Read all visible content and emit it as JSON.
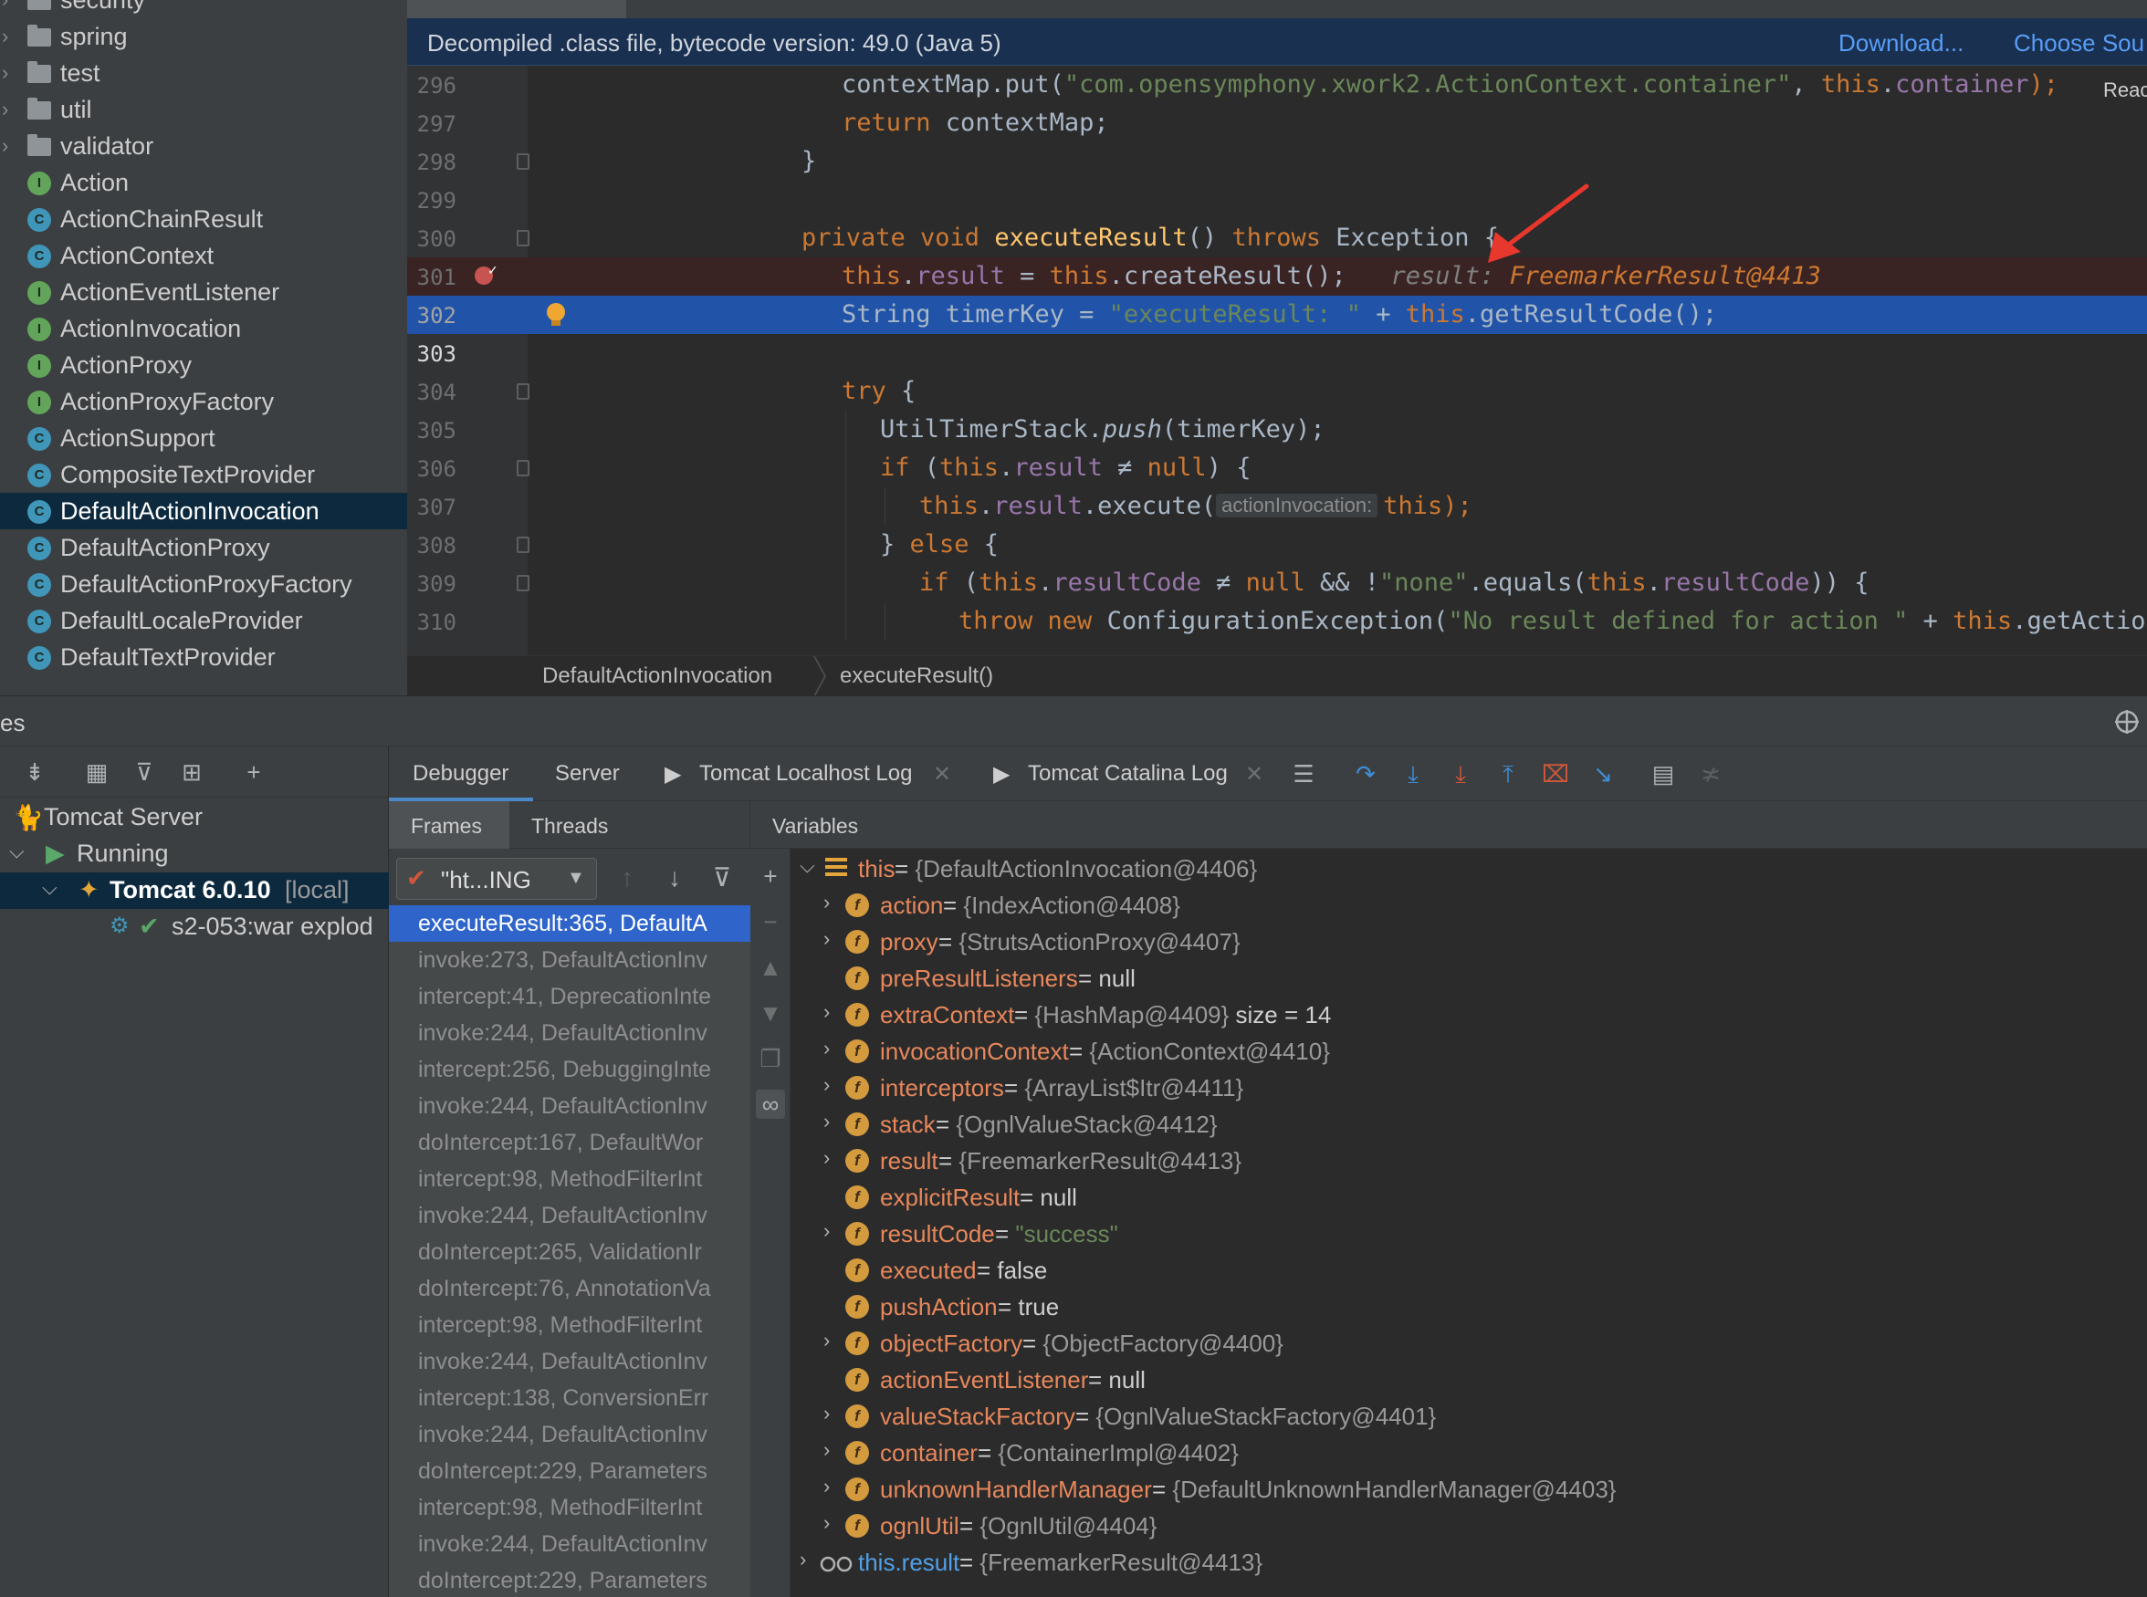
{
  "project": {
    "items": [
      {
        "label": "security",
        "kind": "folder"
      },
      {
        "label": "spring",
        "kind": "folder"
      },
      {
        "label": "test",
        "kind": "folder"
      },
      {
        "label": "util",
        "kind": "folder"
      },
      {
        "label": "validator",
        "kind": "folder"
      },
      {
        "label": "Action",
        "kind": "interface"
      },
      {
        "label": "ActionChainResult",
        "kind": "class"
      },
      {
        "label": "ActionContext",
        "kind": "class"
      },
      {
        "label": "ActionEventListener",
        "kind": "interface"
      },
      {
        "label": "ActionInvocation",
        "kind": "interface"
      },
      {
        "label": "ActionProxy",
        "kind": "interface"
      },
      {
        "label": "ActionProxyFactory",
        "kind": "interface"
      },
      {
        "label": "ActionSupport",
        "kind": "class"
      },
      {
        "label": "CompositeTextProvider",
        "kind": "class"
      },
      {
        "label": "DefaultActionInvocation",
        "kind": "class",
        "selected": true
      },
      {
        "label": "DefaultActionProxy",
        "kind": "class"
      },
      {
        "label": "DefaultActionProxyFactory",
        "kind": "class"
      },
      {
        "label": "DefaultLocaleProvider",
        "kind": "class"
      },
      {
        "label": "DefaultTextProvider",
        "kind": "class"
      }
    ],
    "class_icon_letter": "C",
    "interface_icon_letter": "I"
  },
  "editor": {
    "banner": {
      "text": "Decompiled .class file, bytecode version: 49.0 (Java 5)",
      "download": "Download...",
      "choose_sources": "Choose Sou"
    },
    "read_label": "Reac",
    "line_numbers": [
      "296",
      "297",
      "298",
      "299",
      "300",
      "301",
      "302",
      "303",
      "304",
      "305",
      "306",
      "307",
      "308",
      "309",
      "310"
    ],
    "code": {
      "l296": {
        "a": "contextMap.put(",
        "b": "\"com.opensymphony.xwork2.ActionContext.container\"",
        "c": ", ",
        "d": "this",
        "e": ".",
        "f": "container",
        "g": ");"
      },
      "l297": {
        "a": "return",
        "b": " contextMap;"
      },
      "l298": {
        "a": "}"
      },
      "l300": {
        "a": "private void ",
        "b": "executeResult",
        "c": "() ",
        "d": "throws",
        "e": " Exception {"
      },
      "l301": {
        "a": "this",
        "b": ".",
        "c": "result",
        "d": " = ",
        "e": "this",
        "f": ".createResult();",
        "hint": "result: ",
        "hint_val": "FreemarkerResult@4413"
      },
      "l302": {
        "a": "String timerKey = ",
        "b": "\"executeResult: \"",
        "c": " + ",
        "d": "this",
        "e": ".getResultCode();"
      },
      "l304": {
        "a": "try",
        "b": " {"
      },
      "l305": {
        "a": "UtilTimerStack.",
        "b": "push",
        "c": "(timerKey);"
      },
      "l306": {
        "a": "if",
        "b": " (",
        "c": "this",
        "d": ".",
        "e": "result",
        "f": " ≠ ",
        "g": "null",
        "h": ") {"
      },
      "l307": {
        "a": "this",
        "b": ".",
        "c": "result",
        "d": ".execute(",
        "hint": "actionInvocation:",
        "e": "this",
        "f": ");"
      },
      "l308": {
        "a": "} ",
        "b": "else",
        "c": " {"
      },
      "l309": {
        "a": "if",
        "b": " (",
        "c": "this",
        "d": ".",
        "e": "resultCode",
        "f": " ≠ ",
        "g": "null",
        "h": " && !",
        "i": "\"none\"",
        "j": ".equals(",
        "k": "this",
        "l": ".",
        "m": "resultCode",
        "n": ")) {"
      },
      "l310": {
        "a": "throw new",
        "b": " ConfigurationException(",
        "c": "\"No result defined for action \"",
        "d": " + ",
        "e": "this",
        "f": ".getAction().getClas"
      }
    },
    "breadcrumb": [
      "DefaultActionInvocation",
      "executeResult()"
    ]
  },
  "services": {
    "title": "es",
    "tree": [
      {
        "label": "Tomcat Server"
      },
      {
        "label": "Running"
      },
      {
        "label": "Tomcat 6.0.10",
        "suffix": " [local]"
      },
      {
        "label": "s2-053:war explod"
      }
    ]
  },
  "debugger": {
    "tabs": [
      "Debugger",
      "Server",
      "Tomcat Localhost Log",
      "Tomcat Catalina Log"
    ],
    "subtabs": {
      "frames": "Frames",
      "threads": "Threads",
      "variables": "Variables"
    },
    "thread_select": "\"ht...ING",
    "frames": [
      "executeResult:365, DefaultA",
      "invoke:273, DefaultActionInv",
      "intercept:41, DeprecationInte",
      "invoke:244, DefaultActionInv",
      "intercept:256, DebuggingInte",
      "invoke:244, DefaultActionInv",
      "doIntercept:167, DefaultWor",
      "intercept:98, MethodFilterInt",
      "invoke:244, DefaultActionInv",
      "doIntercept:265, ValidationIr",
      "doIntercept:76, AnnotationVa",
      "intercept:98, MethodFilterInt",
      "invoke:244, DefaultActionInv",
      "intercept:138, ConversionErr",
      "invoke:244, DefaultActionInv",
      "doIntercept:229, Parameters",
      "intercept:98, MethodFilterInt",
      "invoke:244, DefaultActionInv",
      "doIntercept:229, Parameters"
    ],
    "variables": [
      {
        "name": "this",
        "eq": " = ",
        "value": "{DefaultActionInvocation@4406}",
        "kind": "root"
      },
      {
        "name": "action",
        "eq": " = ",
        "value": "{IndexAction@4408}",
        "kind": "obj"
      },
      {
        "name": "proxy",
        "eq": " = ",
        "value": "{StrutsActionProxy@4407}",
        "kind": "obj"
      },
      {
        "name": "preResultListeners",
        "eq": " = ",
        "value": "null",
        "kind": "plain"
      },
      {
        "name": "extraContext",
        "eq": " = ",
        "value": "{HashMap@4409}",
        "extra": "  size = 14",
        "kind": "obj"
      },
      {
        "name": "invocationContext",
        "eq": " = ",
        "value": "{ActionContext@4410}",
        "kind": "obj"
      },
      {
        "name": "interceptors",
        "eq": " = ",
        "value": "{ArrayList$Itr@4411}",
        "kind": "obj"
      },
      {
        "name": "stack",
        "eq": " = ",
        "value": "{OgnlValueStack@4412}",
        "kind": "obj"
      },
      {
        "name": "result",
        "eq": " = ",
        "value": "{FreemarkerResult@4413}",
        "kind": "obj"
      },
      {
        "name": "explicitResult",
        "eq": " = ",
        "value": "null",
        "kind": "plain"
      },
      {
        "name": "resultCode",
        "eq": " = ",
        "value": "\"success\"",
        "kind": "str"
      },
      {
        "name": "executed",
        "eq": " = ",
        "value": "false",
        "kind": "plain"
      },
      {
        "name": "pushAction",
        "eq": " = ",
        "value": "true",
        "kind": "plain"
      },
      {
        "name": "objectFactory",
        "eq": " = ",
        "value": "{ObjectFactory@4400}",
        "kind": "obj"
      },
      {
        "name": "actionEventListener",
        "eq": " = ",
        "value": "null",
        "kind": "plain"
      },
      {
        "name": "valueStackFactory",
        "eq": " = ",
        "value": "{OgnlValueStackFactory@4401}",
        "kind": "obj"
      },
      {
        "name": "container",
        "eq": " = ",
        "value": "{ContainerImpl@4402}",
        "kind": "obj"
      },
      {
        "name": "unknownHandlerManager",
        "eq": " = ",
        "value": "{DefaultUnknownHandlerManager@4403}",
        "kind": "obj"
      },
      {
        "name": "ognlUtil",
        "eq": " = ",
        "value": "{OgnlUtil@4404}",
        "kind": "obj"
      },
      {
        "name": "this.result",
        "eq": " = ",
        "value": "{FreemarkerResult@4413}",
        "kind": "watch"
      }
    ],
    "field_icon_letter": "f"
  },
  "colors": {
    "selection": "#2154a8",
    "breakpoint": "#c75450",
    "keyword": "#cc7832",
    "string": "#6a8759",
    "field": "#9876aa",
    "arrow": "#e8372c"
  }
}
